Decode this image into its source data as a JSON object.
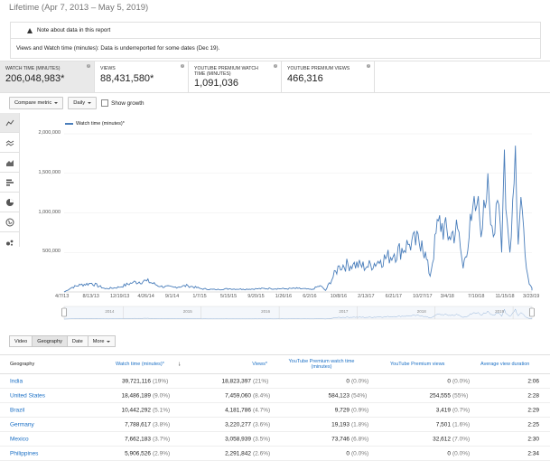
{
  "header": {
    "title": "Lifetime (Apr 7, 2013 – May 5, 2019)"
  },
  "note": {
    "title": "Note about data in this report",
    "body": "Views and Watch time (minutes): Data is underreported for some dates (Dec 19)."
  },
  "metrics": [
    {
      "label": "WATCH TIME (MINUTES)",
      "value": "206,048,983*"
    },
    {
      "label": "VIEWS",
      "value": "88,431,580*"
    },
    {
      "label": "YOUTUBE PREMIUM WATCH TIME (MINUTES)",
      "value": "1,091,036"
    },
    {
      "label": "YOUTUBE PREMIUM VIEWS",
      "value": "466,316"
    }
  ],
  "controls": {
    "compare": "Compare metric",
    "interval": "Daily",
    "show_growth": "Show growth"
  },
  "sidebar_icons": [
    "line-chart-icon",
    "multi-line-icon",
    "area-chart-icon",
    "bar-chart-icon",
    "pie-chart-icon",
    "globe-icon",
    "bubble-chart-icon"
  ],
  "chart_data": {
    "type": "line",
    "legend": "Watch time (minutes)*",
    "yticks": [
      "2,000,000",
      "1,500,000",
      "1,000,000",
      "500,000"
    ],
    "ylim": [
      0,
      2000000
    ],
    "xticks": [
      "4/7/13",
      "8/13/13",
      "12/19/13",
      "4/26/14",
      "9/1/14",
      "1/7/15",
      "5/15/15",
      "9/20/15",
      "1/26/16",
      "6/2/16",
      "10/8/16",
      "2/13/17",
      "6/21/17",
      "10/27/17",
      "3/4/18",
      "7/10/18",
      "11/15/18",
      "3/23/19"
    ],
    "navigator_years": [
      "2014",
      "2015",
      "2016",
      "2017",
      "2018",
      "2019"
    ],
    "series": [
      {
        "name": "Watch time (minutes)*",
        "color": "#4a7ebb",
        "x": [
          0,
          0.3,
          0.6,
          1,
          1.5,
          2,
          2.5,
          3,
          3.5,
          4,
          4.5,
          5,
          5.5,
          6,
          6.5,
          7,
          7.5,
          8,
          8.5,
          9,
          9.3,
          9.5,
          10,
          10.5,
          11,
          11.5,
          12,
          12.5,
          13,
          13.3,
          13.6,
          14,
          14.3,
          14.5,
          14.8,
          15,
          15.2,
          15.4,
          15.6,
          15.8,
          15.9,
          16,
          16.1,
          16.2,
          16.4,
          16.5,
          16.6,
          16.7,
          16.8,
          16.9,
          17,
          17
        ],
        "y": [
          0,
          60000,
          90000,
          110000,
          40000,
          60000,
          120000,
          140000,
          70000,
          60000,
          80000,
          40000,
          30000,
          40000,
          35000,
          40000,
          45000,
          40000,
          45000,
          30000,
          80000,
          20000,
          330000,
          350000,
          320000,
          400000,
          480000,
          600000,
          650000,
          200000,
          900000,
          700000,
          800000,
          300000,
          900000,
          1100000,
          800000,
          1500000,
          700000,
          1100000,
          500000,
          1800000,
          900000,
          500000,
          1850000,
          600000,
          1200000,
          800000,
          300000,
          100000,
          50000,
          20000
        ]
      }
    ]
  },
  "table_tabs": [
    "Video",
    "Geography",
    "Date",
    "More"
  ],
  "table": {
    "headers": [
      "Geography",
      "Watch time (minutes)*",
      "Views*",
      "YouTube Premium watch time (minutes)",
      "YouTube Premium views",
      "Average view duration"
    ],
    "rows": [
      {
        "geo": "India",
        "watch": "39,721,116",
        "watch_pct": "(19%)",
        "views": "18,823,397",
        "views_pct": "(21%)",
        "prem_watch": "0",
        "prem_watch_pct": "(0.0%)",
        "prem_views": "0",
        "prem_views_pct": "(0.0%)",
        "avd": "2:06"
      },
      {
        "geo": "United States",
        "watch": "18,486,189",
        "watch_pct": "(9.0%)",
        "views": "7,459,060",
        "views_pct": "(8.4%)",
        "prem_watch": "584,123",
        "prem_watch_pct": "(54%)",
        "prem_views": "254,555",
        "prem_views_pct": "(55%)",
        "avd": "2:28"
      },
      {
        "geo": "Brazil",
        "watch": "10,442,292",
        "watch_pct": "(5.1%)",
        "views": "4,181,786",
        "views_pct": "(4.7%)",
        "prem_watch": "9,729",
        "prem_watch_pct": "(0.9%)",
        "prem_views": "3,419",
        "prem_views_pct": "(0.7%)",
        "avd": "2:29"
      },
      {
        "geo": "Germany",
        "watch": "7,788,617",
        "watch_pct": "(3.8%)",
        "views": "3,220,277",
        "views_pct": "(3.6%)",
        "prem_watch": "19,193",
        "prem_watch_pct": "(1.8%)",
        "prem_views": "7,501",
        "prem_views_pct": "(1.6%)",
        "avd": "2:25"
      },
      {
        "geo": "Mexico",
        "watch": "7,662,183",
        "watch_pct": "(3.7%)",
        "views": "3,058,939",
        "views_pct": "(3.5%)",
        "prem_watch": "73,746",
        "prem_watch_pct": "(6.8%)",
        "prem_views": "32,612",
        "prem_views_pct": "(7.0%)",
        "avd": "2:30"
      },
      {
        "geo": "Philippines",
        "watch": "5,906,526",
        "watch_pct": "(2.9%)",
        "views": "2,291,842",
        "views_pct": "(2.6%)",
        "prem_watch": "0",
        "prem_watch_pct": "(0.0%)",
        "prem_views": "0",
        "prem_views_pct": "(0.0%)",
        "avd": "2:34"
      }
    ]
  }
}
